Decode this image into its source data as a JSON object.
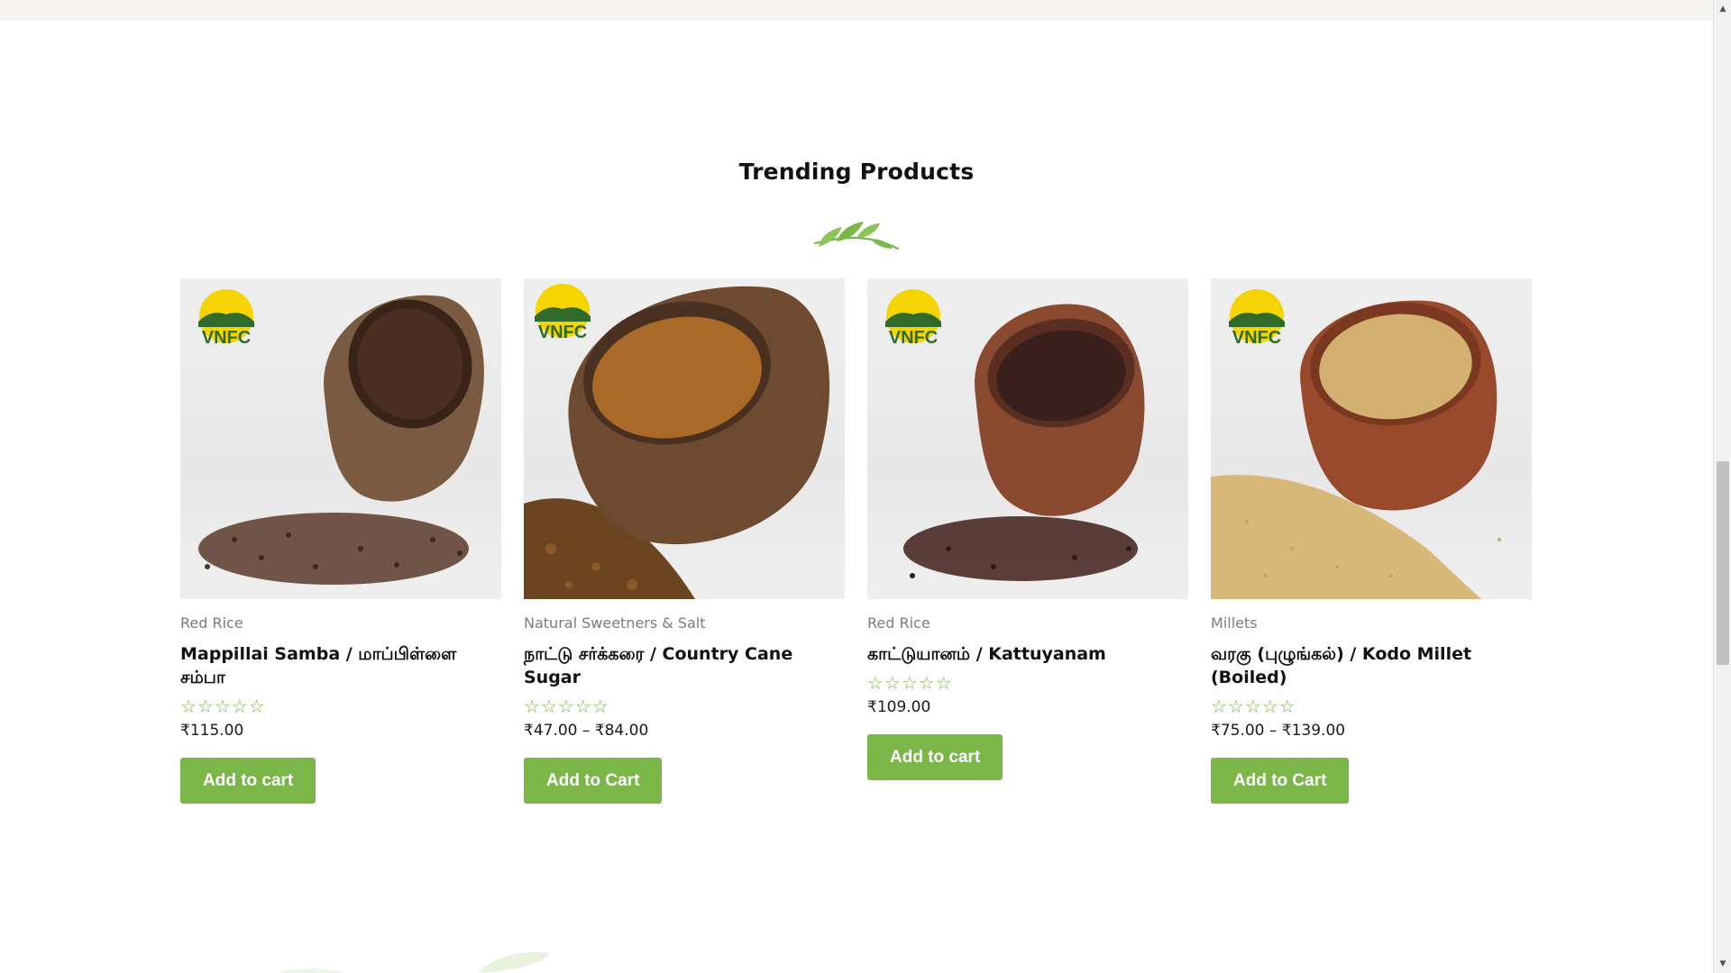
{
  "section": {
    "title": "Trending Products",
    "decoration_icon": "leaf-branch-icon"
  },
  "colors": {
    "accent": "#7ab648",
    "title": "#111111",
    "category": "#7b7b7b",
    "star": "#7ab648"
  },
  "products": [
    {
      "category": "Red Rice",
      "title": "Mappillai Samba / மாப்பிள்ளை சம்பா",
      "rating_stars": "☆☆☆☆☆",
      "price": "₹115.00",
      "button": "Add to cart",
      "logo_text": "VNFC"
    },
    {
      "category": "Natural Sweetners & Salt",
      "title": "நாட்டு சர்க்கரை / Country Cane Sugar",
      "rating_stars": "☆☆☆☆☆",
      "price": "₹47.00 – ₹84.00",
      "button": "Add to Cart",
      "logo_text": "VNFC"
    },
    {
      "category": "Red Rice",
      "title": "காட்டுயானம் / Kattuyanam",
      "rating_stars": "☆☆☆☆☆",
      "price": "₹109.00",
      "button": "Add to cart",
      "logo_text": "VNFC"
    },
    {
      "category": "Millets",
      "title": "வரகு (புழுங்கல்) / Kodo Millet (Boiled)",
      "rating_stars": "☆☆☆☆☆",
      "price": "₹75.00 – ₹139.00",
      "button": "Add to Cart",
      "logo_text": "VNFC"
    }
  ],
  "scrollbar": {
    "up_icon": "scroll-up-arrow-icon",
    "down_icon": "scroll-down-arrow-icon"
  }
}
